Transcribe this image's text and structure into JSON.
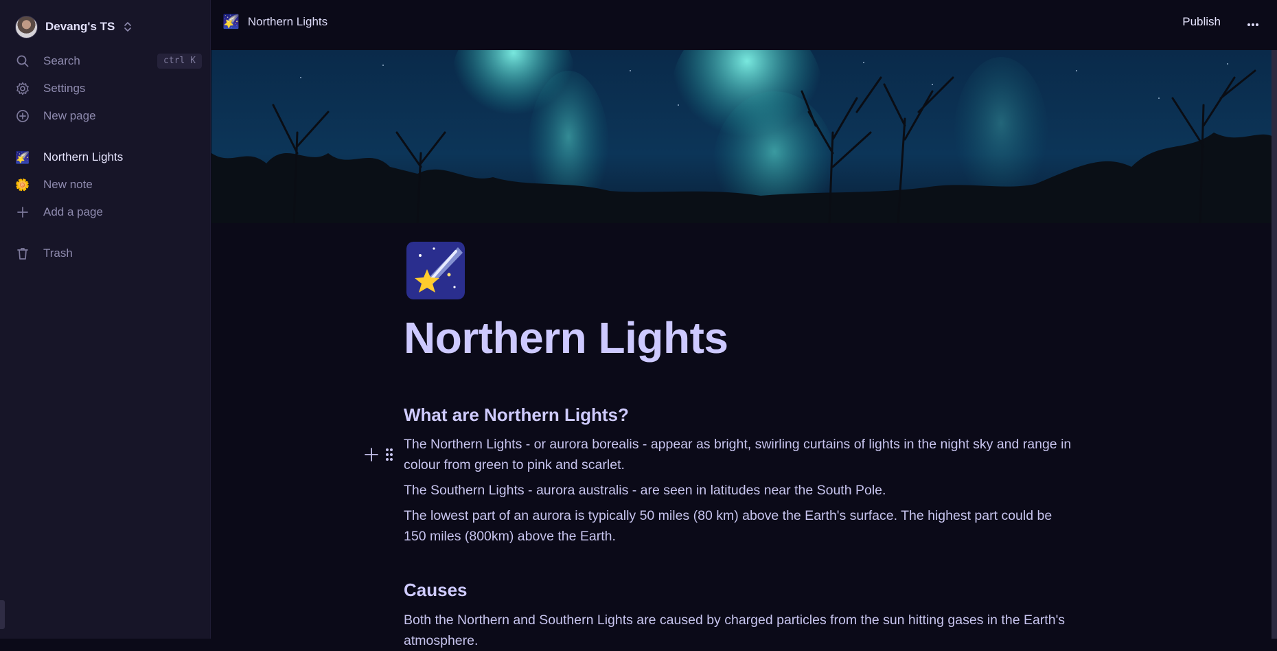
{
  "sidebar": {
    "workspace_name": "Devang's TS",
    "search_label": "Search",
    "search_shortcut": "ctrl K",
    "settings_label": "Settings",
    "new_page_label": "New page",
    "pages": [
      {
        "emoji": "🌠",
        "label": "Northern Lights",
        "active": true
      },
      {
        "emoji": "🌼",
        "label": "New note",
        "active": false
      }
    ],
    "add_page_label": "Add a page",
    "trash_label": "Trash"
  },
  "topbar": {
    "breadcrumb_emoji": "🌠",
    "breadcrumb_title": "Northern Lights",
    "publish_label": "Publish"
  },
  "page": {
    "icon_emoji": "🌠",
    "title": "Northern Lights",
    "sections": [
      {
        "heading": "What are Northern Lights?",
        "paragraphs": [
          "The Northern Lights - or aurora borealis - appear as bright, swirling curtains of lights in the night sky and range in colour from green to pink and scarlet.",
          "The Southern Lights - aurora australis - are seen in latitudes near the South Pole.",
          "The lowest part of an aurora is typically 50 miles (80 km) above the Earth's surface. The highest part could be 150 miles (800km) above the Earth."
        ]
      },
      {
        "heading": "Causes",
        "paragraphs": [
          "Both the Northern and Southern Lights are caused by charged particles from the sun hitting gases in the Earth's atmosphere."
        ]
      }
    ]
  },
  "colors": {
    "background": "#0b0a18",
    "sidebar": "#171528",
    "title": "#cdc9ff",
    "text": "#c7c4ee",
    "muted": "#8e8aae"
  }
}
